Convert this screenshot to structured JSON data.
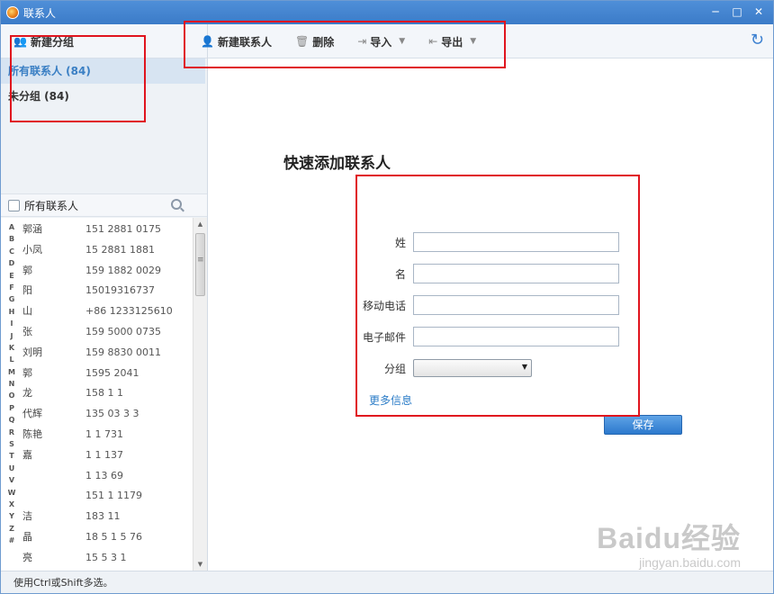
{
  "window": {
    "title": "联系人",
    "minimize": "─",
    "maximize": "□",
    "close": "✕"
  },
  "toolbar": {
    "new_group": "新建分组",
    "new_contact": "新建联系人",
    "delete": "删除",
    "import": "导入",
    "export": "导出",
    "refresh_glyph": "↻"
  },
  "sidebar": {
    "groups": [
      {
        "label": "所有联系人 (84)",
        "active": true
      },
      {
        "label": "未分组 (84)",
        "active": false
      }
    ],
    "list_header": "所有联系人",
    "letters": [
      "A",
      "B",
      "C",
      "D",
      "E",
      "F",
      "G",
      "H",
      "I",
      "J",
      "K",
      "L",
      "M",
      "N",
      "O",
      "P",
      "Q",
      "R",
      "S",
      "T",
      "U",
      "V",
      "W",
      "X",
      "Y",
      "Z",
      "#"
    ],
    "contacts": [
      {
        "name": "郭涵",
        "phone": "151 2881 0175"
      },
      {
        "name": "小凤",
        "phone": "15 2881 1881"
      },
      {
        "name": "郭",
        "phone": "159 1882 0029"
      },
      {
        "name": "阳",
        "phone": "15019316737"
      },
      {
        "name": "山",
        "phone": "+86 1233125610"
      },
      {
        "name": "张",
        "phone": "159 5000 0735"
      },
      {
        "name": "刘明",
        "phone": "159 8830 0011"
      },
      {
        "name": "郭",
        "phone": "1595 2041"
      },
      {
        "name": "龙",
        "phone": "158 1 1"
      },
      {
        "name": "代辉",
        "phone": "135 03 3 3"
      },
      {
        "name": "陈艳",
        "phone": "1 1 731"
      },
      {
        "name": "嘉",
        "phone": "1 1 137"
      },
      {
        "name": "",
        "phone": "1 13 69"
      },
      {
        "name": "",
        "phone": "151 1 1179"
      },
      {
        "name": "洁",
        "phone": "183 11"
      },
      {
        "name": "晶",
        "phone": "18 5 1 5 76"
      },
      {
        "name": "亮",
        "phone": "15 5 3 1"
      }
    ]
  },
  "form": {
    "title": "快速添加联系人",
    "fields": [
      {
        "label": "姓",
        "value": ""
      },
      {
        "label": "名",
        "value": ""
      },
      {
        "label": "移动电话",
        "value": ""
      },
      {
        "label": "电子邮件",
        "value": ""
      }
    ],
    "group_label": "分组",
    "group_value": "",
    "more_info": "更多信息",
    "save": "保存"
  },
  "statusbar": {
    "text": "使用Ctrl或Shift多选。"
  },
  "watermark": {
    "brand": "Baidu经验",
    "url": "jingyan.baidu.com"
  },
  "colors": {
    "titlebar": "#3b7bc8",
    "annotation": "#e0141e",
    "link": "#2b7cc7",
    "save_button": "#2c79cd"
  }
}
